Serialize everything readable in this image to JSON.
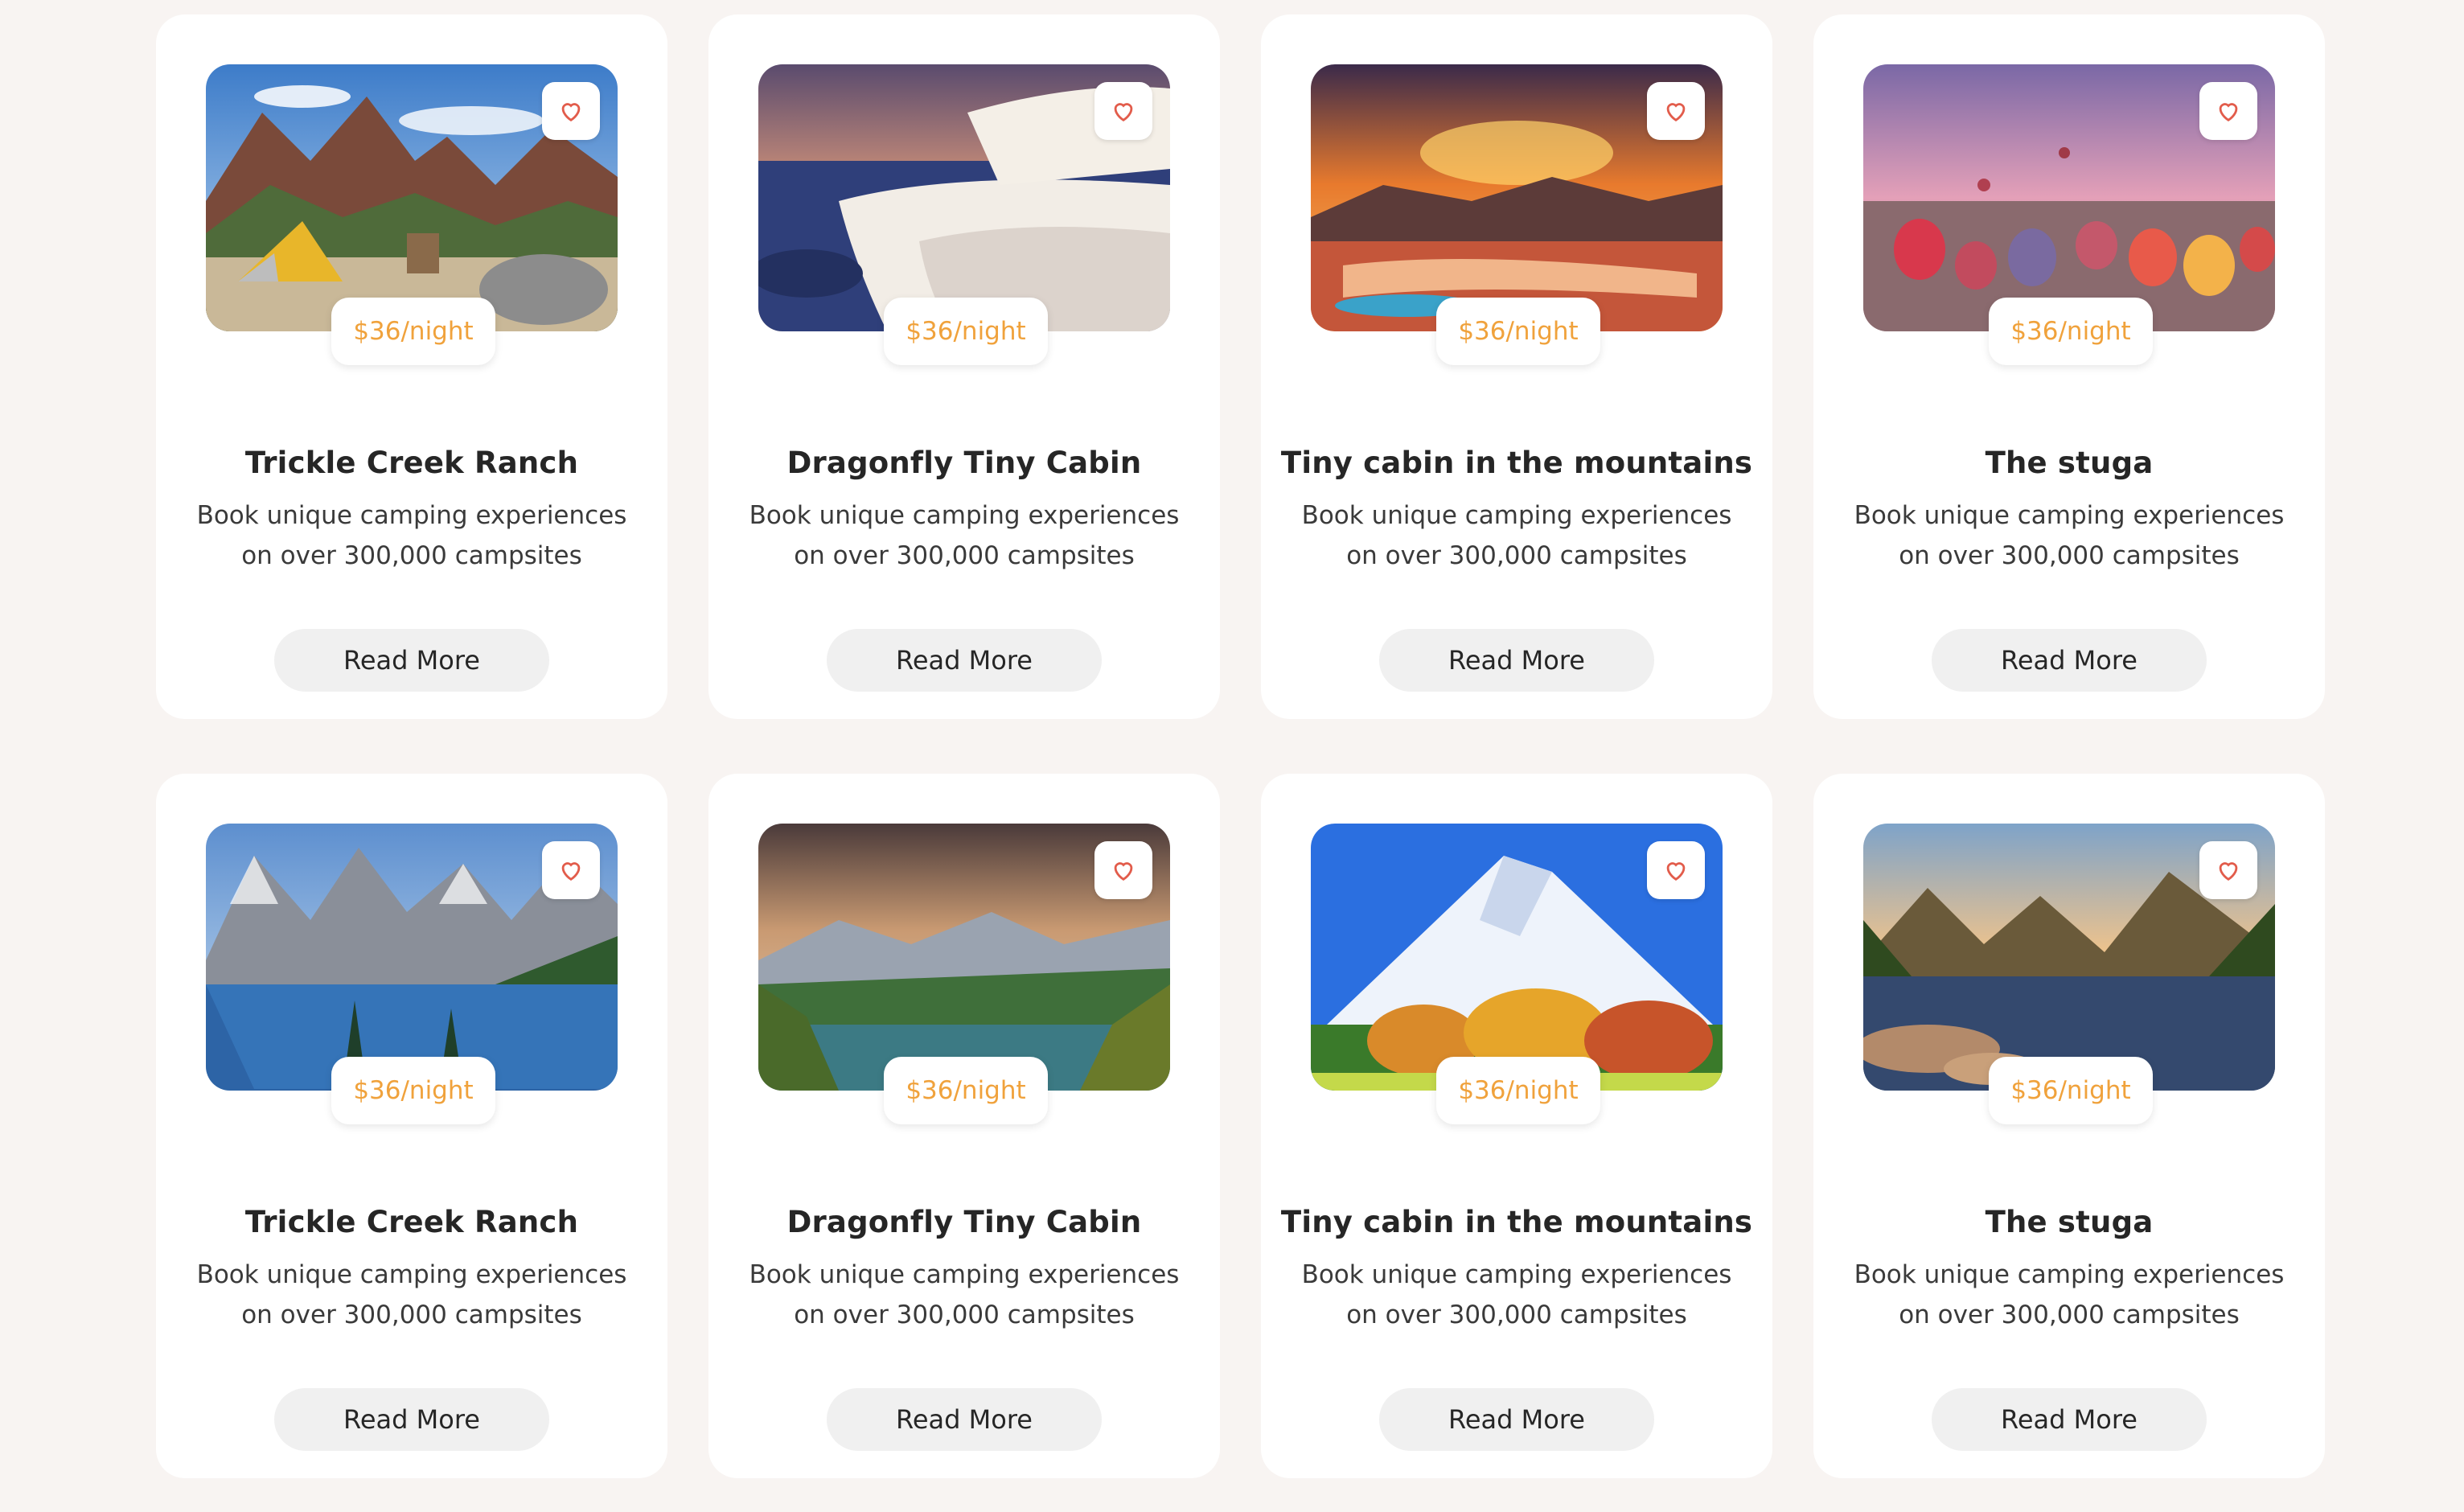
{
  "colors": {
    "background": "#f8f4f2",
    "card": "#ffffff",
    "price": "#f0a23c",
    "heart": "#e25c4b",
    "button": "#f0f0f0"
  },
  "cards": [
    {
      "image": "camp-tent-canyon-photo",
      "favorite_icon": "heart-outline-icon",
      "price": "$36/night",
      "title": "Trickle Creek Ranch",
      "description": "Book unique camping experiences on over 300,000 campsites",
      "button_label": "Read More"
    },
    {
      "image": "terraces-sunset-photo",
      "favorite_icon": "heart-outline-icon",
      "price": "$36/night",
      "title": "Dragonfly Tiny Cabin",
      "description": "Book unique camping experiences on over 300,000 campsites",
      "button_label": "Read More"
    },
    {
      "image": "sunset-pools-photo",
      "favorite_icon": "heart-outline-icon",
      "price": "$36/night",
      "title": "Tiny cabin in the mountains",
      "description": "Book unique camping experiences on over 300,000 campsites",
      "button_label": "Read More"
    },
    {
      "image": "hot-air-balloons-photo",
      "favorite_icon": "heart-outline-icon",
      "price": "$36/night",
      "title": "The stuga",
      "description": "Book unique camping experiences on over 300,000 campsites",
      "button_label": "Read More"
    },
    {
      "image": "mountain-lake-reflection-photo",
      "favorite_icon": "heart-outline-icon",
      "price": "$36/night",
      "title": "Trickle Creek Ranch",
      "description": "Book unique camping experiences on over 300,000 campsites",
      "button_label": "Read More"
    },
    {
      "image": "forest-lake-clouds-photo",
      "favorite_icon": "heart-outline-icon",
      "price": "$36/night",
      "title": "Dragonfly Tiny Cabin",
      "description": "Book unique camping experiences on over 300,000 campsites",
      "button_label": "Read More"
    },
    {
      "image": "snowy-volcano-autumn-photo",
      "favorite_icon": "heart-outline-icon",
      "price": "$36/night",
      "title": "Tiny cabin in the mountains",
      "description": "Book unique camping experiences on over 300,000 campsites",
      "button_label": "Read More"
    },
    {
      "image": "alpine-lake-sunrise-photo",
      "favorite_icon": "heart-outline-icon",
      "price": "$36/night",
      "title": "The stuga",
      "description": "Book unique camping experiences on over 300,000 campsites",
      "button_label": "Read More"
    }
  ]
}
